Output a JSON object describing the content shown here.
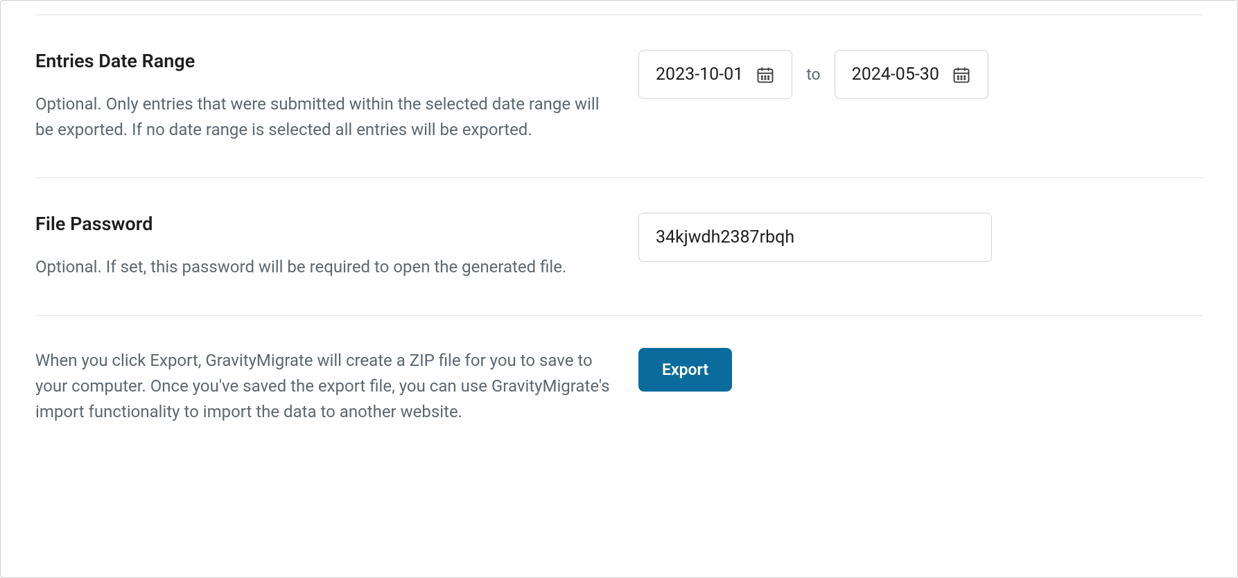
{
  "date_range": {
    "title": "Entries Date Range",
    "description": "Optional. Only entries that were submitted within the selected date range will be exported. If no date range is selected all entries will be exported.",
    "start_value": "2023-10-01",
    "to_label": "to",
    "end_value": "2024-05-30"
  },
  "file_password": {
    "title": "File Password",
    "description": "Optional. If set, this password will be required to open the generated file.",
    "value": "34kjwdh2387rbqh"
  },
  "export": {
    "description": "When you click Export, GravityMigrate will create a ZIP file for you to save to your computer. Once you've saved the export file, you can use GravityMigrate's import functionality to import the data to another website.",
    "button_label": "Export"
  }
}
